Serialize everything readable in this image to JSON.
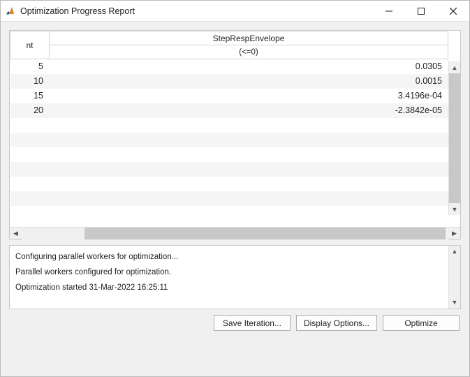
{
  "window": {
    "title": "Optimization Progress Report"
  },
  "table": {
    "col1_header": "nt",
    "col2_header": "StepRespEnvelope",
    "col2_sub": "(<=0)",
    "rows": [
      {
        "iter": "5",
        "val": "0.0305"
      },
      {
        "iter": "10",
        "val": "0.0015"
      },
      {
        "iter": "15",
        "val": "3.4196e-04"
      },
      {
        "iter": "20",
        "val": "-2.3842e-05"
      }
    ]
  },
  "log": {
    "line1": "Configuring parallel workers for optimization...",
    "line2": "Parallel workers configured for optimization.",
    "line3": "Optimization started 31-Mar-2022 16:25:11"
  },
  "buttons": {
    "save": "Save Iteration...",
    "options": "Display Options...",
    "optimize": "Optimize"
  }
}
